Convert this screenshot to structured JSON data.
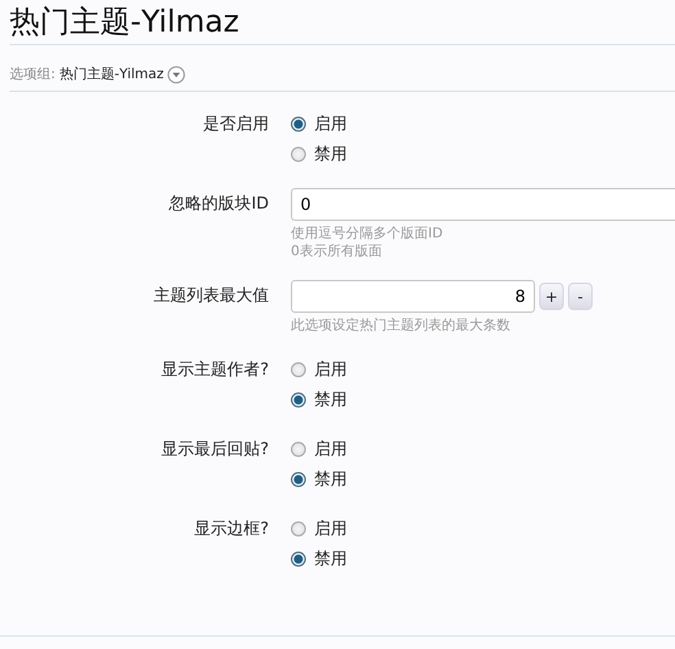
{
  "header": {
    "title": "热门主题-Yilmaz"
  },
  "option_group": {
    "label": "选项组:",
    "value": "热门主题-Yilmaz"
  },
  "rows": [
    {
      "kind": "radio",
      "label": "是否启用",
      "options": [
        {
          "label": "启用",
          "selected": true
        },
        {
          "label": "禁用",
          "selected": false
        }
      ]
    },
    {
      "kind": "text",
      "label": "忽略的版块ID",
      "value": "0",
      "hints": [
        "使用逗号分隔多个版面ID",
        "0表示所有版面"
      ]
    },
    {
      "kind": "number",
      "label": "主题列表最大值",
      "value": "8",
      "buttons": [
        "+",
        "-"
      ],
      "hints": [
        "此选项设定热门主题列表的最大条数"
      ]
    },
    {
      "kind": "radio",
      "label": "显示主题作者?",
      "options": [
        {
          "label": "启用",
          "selected": false
        },
        {
          "label": "禁用",
          "selected": true
        }
      ]
    },
    {
      "kind": "radio",
      "label": "显示最后回贴?",
      "options": [
        {
          "label": "启用",
          "selected": false
        },
        {
          "label": "禁用",
          "selected": true
        }
      ]
    },
    {
      "kind": "radio",
      "label": "显示边框?",
      "options": [
        {
          "label": "启用",
          "selected": false
        },
        {
          "label": "禁用",
          "selected": true
        }
      ]
    }
  ]
}
